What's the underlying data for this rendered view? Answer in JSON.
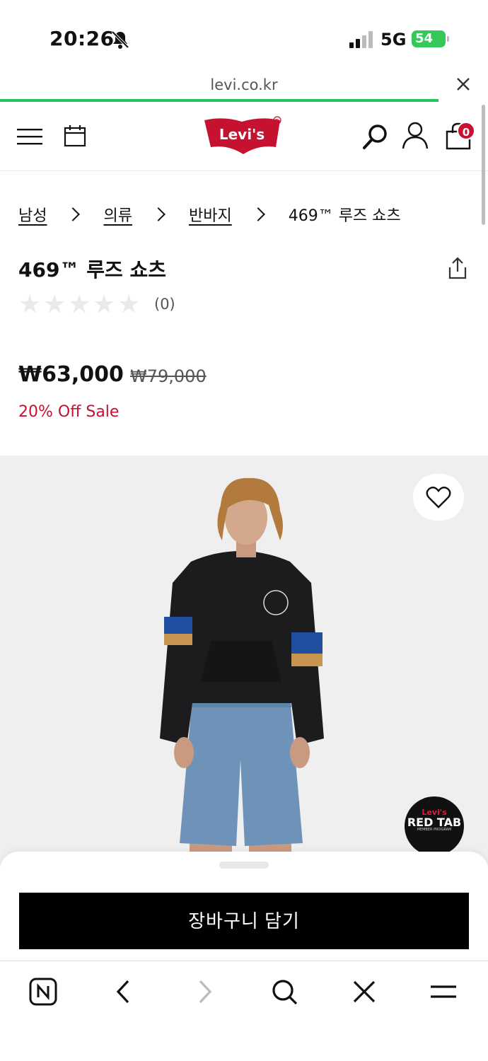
{
  "status": {
    "time": "20:26",
    "network": "5G",
    "battery": "54"
  },
  "browser": {
    "url": "levi.co.kr"
  },
  "header": {
    "logo_text": "Levi's",
    "cart_count": "0"
  },
  "breadcrumb": [
    {
      "label": "남성",
      "link": true
    },
    {
      "label": "의류",
      "link": true
    },
    {
      "label": "반바지",
      "link": true
    },
    {
      "label": "469™ 루즈 쇼츠",
      "link": false
    }
  ],
  "product": {
    "title": "469™ 루즈 쇼츠",
    "rating_count": "(0)",
    "stars_filled": 0,
    "stars_total": 5,
    "price_sale": "₩63,000",
    "price_original": "₩79,000",
    "discount_label": "20% Off Sale"
  },
  "badge": {
    "line1": "Levi's",
    "line2": "RED TAB",
    "line3": "MEMBER PROGRAM"
  },
  "actions": {
    "add_to_cart": "장바구니 담기"
  },
  "colors": {
    "accent_red": "#c41230",
    "load_bar": "#22c55e",
    "button_bg": "#000000"
  },
  "icons": [
    "bell-slash-icon",
    "signal-icon",
    "close-icon",
    "menu-icon",
    "calendar-icon",
    "search-icon",
    "user-icon",
    "bag-icon",
    "share-icon",
    "heart-icon",
    "naver-icon",
    "back-icon",
    "forward-icon",
    "search-icon",
    "close-icon",
    "menu-icon"
  ]
}
